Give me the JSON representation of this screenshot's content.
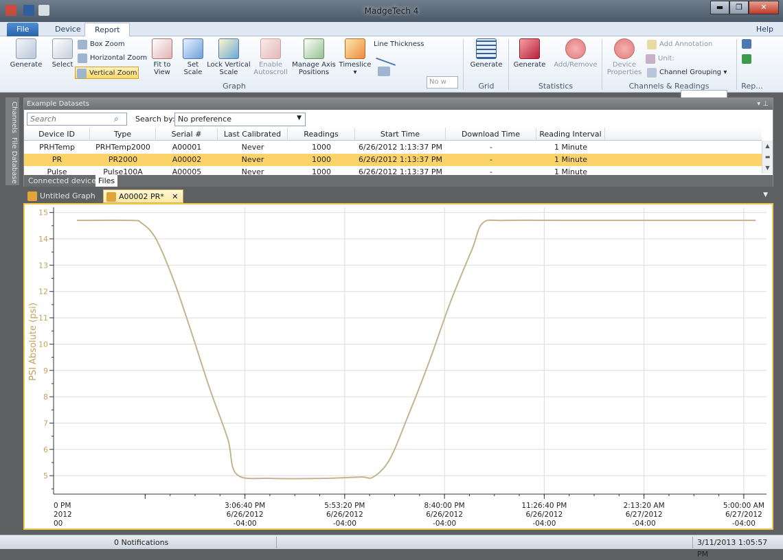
{
  "window": {
    "title": "MadgeTech 4",
    "min": "▬",
    "max": "❐",
    "close": "✕"
  },
  "menu": {
    "file": "File",
    "device": "Device",
    "report": "Report",
    "help": "Help"
  },
  "ribbon": {
    "generate": "Generate",
    "select": "Select",
    "box_zoom": "Box Zoom",
    "horizontal_zoom": "Horizontal Zoom",
    "vertical_zoom": "Vertical Zoom",
    "fit_to_view": [
      "Fit to",
      "View"
    ],
    "set_scale": [
      "Set",
      "Scale"
    ],
    "lock_vertical_scale": [
      "Lock Vertical",
      "Scale"
    ],
    "enable_autoscroll": [
      "Enable",
      "Autoscroll"
    ],
    "manage_axis_positions": [
      "Manage Axis",
      "Positions"
    ],
    "timeslice": "Timeslice",
    "line_thickness": "Line Thickness",
    "line_thickness_value": "No w",
    "graph_group": "Graph",
    "grid_generate": "Generate",
    "grid_group": "Grid",
    "stats_generate": "Generate",
    "add_remove": "Add/Remove",
    "statistics_group": "Statistics",
    "device_properties": [
      "Device",
      "Properties"
    ],
    "add_annotation": "Add Annotation",
    "unit": "Unit:",
    "channel_grouping": "Channel Grouping",
    "channels_group": "Channels & Readings",
    "rep_group": "Rep..."
  },
  "side_tabs": [
    "Channels",
    "File Database"
  ],
  "datasets": {
    "title": "Example Datasets",
    "search_placeholder": "Search",
    "search_by_label": "Search by:",
    "search_by_value": "No preference",
    "columns": [
      "Device ID",
      "Type",
      "Serial #",
      "Last Calibrated",
      "Readings",
      "Start Time",
      "Download Time",
      "Reading Interval"
    ],
    "rows": [
      [
        "PRHTemp",
        "PRHTemp2000",
        "A00001",
        "Never",
        "1000",
        "6/26/2012 1:13:37 PM",
        "-",
        "1 Minute"
      ],
      [
        "PR",
        "PR2000",
        "A00002",
        "Never",
        "1000",
        "6/26/2012 1:13:37 PM",
        "-",
        "1 Minute"
      ],
      [
        "Pulse",
        "Pulse100A",
        "A00005",
        "Never",
        "1000",
        "6/26/2012 1:13:37 PM",
        "-",
        "1 Minute"
      ]
    ],
    "tabs": [
      "Connected devices",
      "Files"
    ]
  },
  "doc_tabs": {
    "untitled": "Untitled Graph",
    "active": "A00002 PR*",
    "close": "✕"
  },
  "status": {
    "notifications": "0 Notifications",
    "datetime": "3/11/2013 1:05:57 PM"
  },
  "chart_data": {
    "type": "line",
    "ylabel": "PSI Absolute (psi)",
    "ylim": [
      4.3,
      15.2
    ],
    "yticks": [
      5,
      6,
      7,
      8,
      9,
      10,
      11,
      12,
      13,
      14,
      15
    ],
    "xticks": [
      [
        "0 PM",
        "2012",
        "00"
      ],
      [
        "3:06:40 PM",
        "6/26/2012",
        "-04:00"
      ],
      [
        "5:53:20 PM",
        "6/26/2012",
        "-04:00"
      ],
      [
        "8:40:00 PM",
        "6/26/2012",
        "-04:00"
      ],
      [
        "11:26:40 PM",
        "6/26/2012",
        "-04:00"
      ],
      [
        "2:13:20 AM",
        "6/27/2012",
        "-04:00"
      ],
      [
        "5:00:00 AM",
        "6/27/2012",
        "-04:00"
      ]
    ],
    "series": [
      {
        "color": "#c4b48e",
        "x_hours": [
          -1.9,
          -0.4,
          -0.1,
          0.3,
          0.8,
          1.3,
          1.8,
          2.3,
          2.55,
          3.5,
          5.0,
          6.0,
          6.35,
          6.8,
          7.3,
          7.9,
          8.5,
          9.1,
          9.4,
          10.0,
          12.0,
          14.0,
          16.0,
          17.0
        ],
        "values": [
          14.7,
          14.7,
          14.6,
          14.0,
          12.4,
          10.4,
          8.3,
          6.4,
          5.05,
          4.9,
          4.9,
          4.95,
          4.95,
          5.6,
          7.2,
          9.3,
          11.6,
          13.6,
          14.6,
          14.7,
          14.7,
          14.7,
          14.7,
          14.7
        ]
      }
    ]
  }
}
